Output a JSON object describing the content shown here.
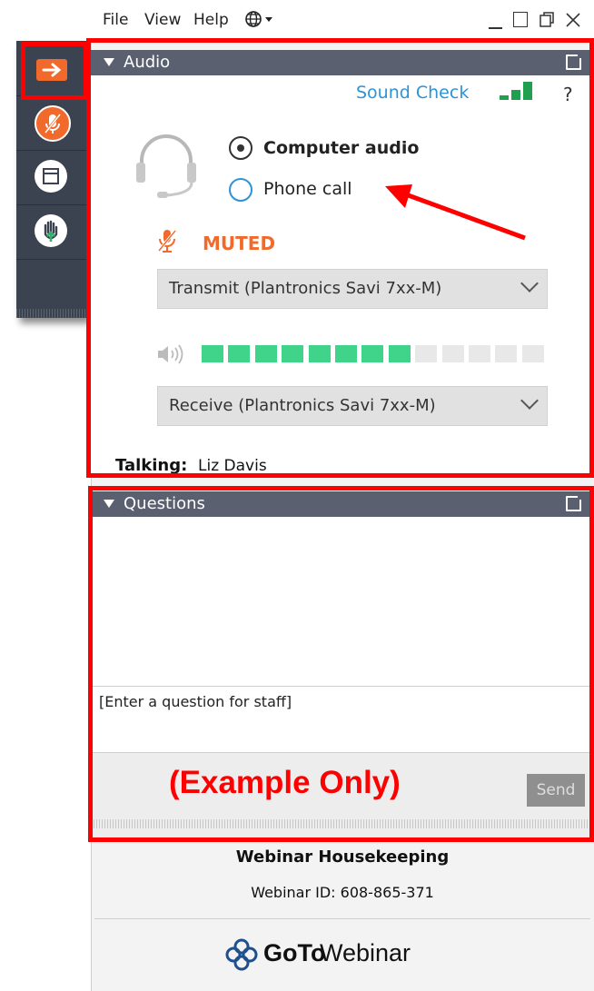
{
  "menu": {
    "file": "File",
    "view": "View",
    "help": "Help"
  },
  "audio": {
    "title": "Audio",
    "sound_check": "Sound Check",
    "help_glyph": "?",
    "computer_audio": "Computer audio",
    "phone_call": "Phone call",
    "muted": "MUTED",
    "transmit": "Transmit (Plantronics Savi 7xx-M)",
    "receive": "Receive (Plantronics Savi 7xx-M)",
    "talking_label": "Talking:",
    "talking_name": "Liz Davis",
    "selected_option": "Computer audio",
    "mic_level": 0.6
  },
  "questions": {
    "title": "Questions",
    "input_placeholder": "[Enter a question for staff]",
    "send": "Send"
  },
  "overlay": {
    "example_note": "(Example Only)"
  },
  "footer": {
    "title": "Webinar Housekeeping",
    "webinar_id": "Webinar ID: 608-865-371",
    "brand_goto": "GoTo",
    "brand_webinar": "Webinar"
  },
  "colors": {
    "accent_orange": "#f26a2b",
    "level_green": "#3fd48a",
    "header": "#5a6070",
    "annotation_red": "#ff0000"
  },
  "icons": [
    "arrow-right-icon",
    "mic-muted-icon",
    "window-icon",
    "raise-hand-icon",
    "headset-icon",
    "speaker-icon",
    "globe-icon",
    "popout-icon",
    "gotowebinar-logo-icon"
  ]
}
